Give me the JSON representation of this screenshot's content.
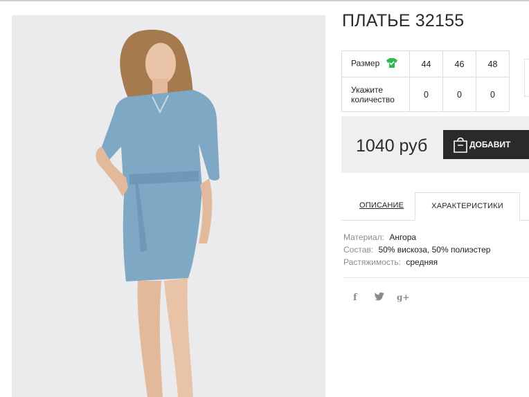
{
  "product": {
    "title": "ПЛАТЬЕ 32155",
    "image_alt": "Голубое платье"
  },
  "size_table": {
    "size_label": "Размер",
    "size_icon": "tshirt-icon",
    "qty_label_line1": "Укажите",
    "qty_label_line2": "количество",
    "sizes": [
      "44",
      "46",
      "48"
    ],
    "quantities": [
      "0",
      "0",
      "0"
    ]
  },
  "purchase": {
    "price": "1040 руб",
    "add_button_label": "ДОБАВИТ",
    "bag_icon": "shopping-bag-icon"
  },
  "tabs": {
    "description": "ОПИСАНИЕ",
    "characteristics": "ХАРАКТЕРИСТИКИ",
    "active": "characteristics"
  },
  "characteristics": [
    {
      "key": "Материал:",
      "value": "Ангора"
    },
    {
      "key": "Состав:",
      "value": "50% вискоза, 50% полиэстер"
    },
    {
      "key": "Растяжимость:",
      "value": "средняя"
    }
  ],
  "social": {
    "facebook": "f",
    "twitter": "twitter-icon",
    "googleplus": "g+"
  },
  "colors": {
    "dress": "#7fa8c4",
    "accent_green": "#2dbb4b",
    "button_bg": "#2a2a2a",
    "price_bar_bg": "#efefef"
  }
}
